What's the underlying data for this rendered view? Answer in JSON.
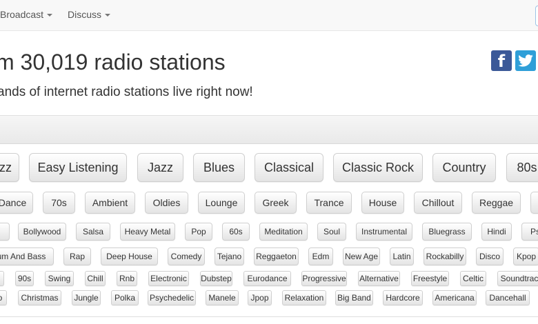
{
  "nav": {
    "items": [
      {
        "label": "Broadcast",
        "id": "broadcast"
      },
      {
        "label": "Discuss",
        "id": "discuss"
      }
    ]
  },
  "header": {
    "title": "m 30,019 radio stations",
    "subtitle": "ands of internet radio stations live right now!"
  },
  "social": {
    "facebook_glyph": "f",
    "icons": [
      "facebook-icon",
      "twitter-icon"
    ],
    "colors": {
      "facebook": "#3b5998",
      "twitter": "#2f9fd8"
    }
  },
  "genres": {
    "row1": [
      "zz",
      "Easy Listening",
      "Jazz",
      "Blues",
      "Classical",
      "Classic Rock",
      "Country",
      "80s"
    ],
    "row2": [
      "Dance",
      "70s",
      "Ambient",
      "Oldies",
      "Lounge",
      "Greek",
      "Trance",
      "House",
      "Chillout",
      "Reggae",
      ""
    ],
    "row3": [
      "",
      "Bollywood",
      "Salsa",
      "Heavy Metal",
      "Pop",
      "60s",
      "Meditation",
      "Soul",
      "Instrumental",
      "Bluegrass",
      "Hindi",
      "Ps"
    ],
    "row4": [
      "rum And Bass",
      "Rap",
      "Deep House",
      "Comedy",
      "Tejano",
      "Reggaeton",
      "Edm",
      "New Age",
      "Latin",
      "Rockabilly",
      "Disco",
      "Kpop"
    ],
    "row5": [
      "",
      "90s",
      "Swing",
      "Chill",
      "Rnb",
      "Electronic",
      "Dubstep",
      "Eurodance",
      "Progressive",
      "Alternative",
      "Freestyle",
      "Celtic",
      "Soundtrack"
    ],
    "row6": [
      "o",
      "Christmas",
      "Jungle",
      "Polka",
      "Psychedelic",
      "Manele",
      "Jpop",
      "Relaxation",
      "Big Band",
      "Hardcore",
      "Americana",
      "Dancehall"
    ]
  }
}
